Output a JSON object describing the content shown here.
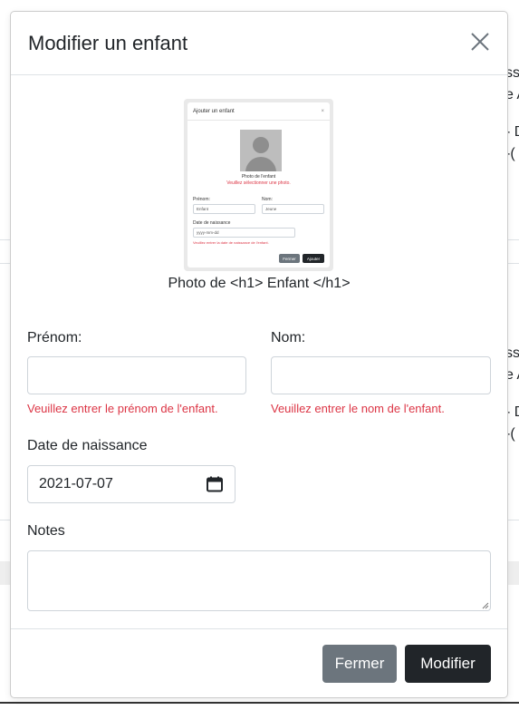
{
  "background": {
    "fragments": [
      "ss",
      "e A",
      "- D",
      "-(",
      "ss",
      "e A",
      "- D",
      "-("
    ]
  },
  "modal": {
    "title": "Modifier un enfant",
    "close_icon": "close-icon"
  },
  "photo": {
    "caption": "Photo de <h1> Enfant </h1>",
    "preview": {
      "title": "Ajouter un enfant",
      "close": "×",
      "photo_label": "Photo de l'enfant",
      "photo_error": "Veuillez sélectionner une photo.",
      "first_name_label": "Prénom:",
      "first_name_value": "Enfant",
      "last_name_label": "Nom:",
      "last_name_value": "Jeune",
      "dob_label": "Date de naissance",
      "dob_placeholder": "yyyy-mm-dd",
      "dob_error": "Veuillez entrer la date de naissance de l'enfant.",
      "cancel": "Fermer",
      "submit": "Ajouter"
    }
  },
  "form": {
    "first_name": {
      "label": "Prénom:",
      "value": "",
      "error": "Veuillez entrer le prénom de l'enfant."
    },
    "last_name": {
      "label": "Nom:",
      "value": "",
      "error": "Veuillez entrer le nom de l'enfant."
    },
    "dob": {
      "label": "Date de naissance",
      "value": "2021-07-07",
      "icon": "calendar-icon"
    },
    "notes": {
      "label": "Notes",
      "value": ""
    }
  },
  "footer": {
    "close_label": "Fermer",
    "submit_label": "Modifier"
  },
  "colors": {
    "error": "#dc3545",
    "secondary": "#6c757d",
    "dark": "#212529"
  }
}
